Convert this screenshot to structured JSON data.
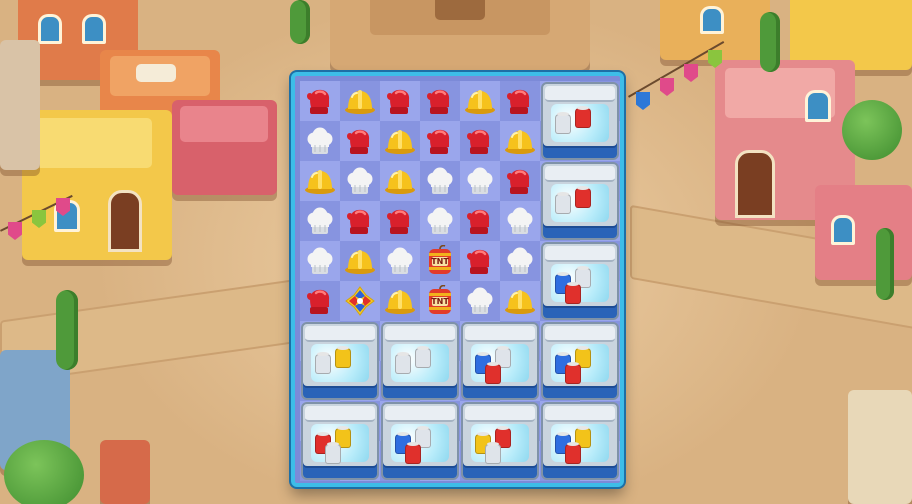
{
  "colors": {
    "board_frame": "#3dbde8",
    "cell_light": "#9aa6ec",
    "cell_dark": "#8794e0",
    "glove": "#d8202c",
    "hardhat": "#f6c21c",
    "chef_hat": "#f4f4f4",
    "tnt": "#e23a2a",
    "cooler_band": "#2a63b8",
    "can_red": "#e0302c",
    "can_blue": "#2f6ee0",
    "can_silver": "#dfe4ea",
    "can_yellow": "#f2c31a"
  },
  "board": {
    "columns": 8,
    "rows": 10,
    "tiles": [
      {
        "col": 0,
        "row": 0,
        "piece": "red-glove"
      },
      {
        "col": 1,
        "row": 0,
        "piece": "yellow-hardhat"
      },
      {
        "col": 2,
        "row": 0,
        "piece": "red-glove"
      },
      {
        "col": 3,
        "row": 0,
        "piece": "red-glove"
      },
      {
        "col": 4,
        "row": 0,
        "piece": "yellow-hardhat"
      },
      {
        "col": 5,
        "row": 0,
        "piece": "red-glove"
      },
      {
        "col": 0,
        "row": 1,
        "piece": "white-chef-hat"
      },
      {
        "col": 1,
        "row": 1,
        "piece": "red-glove"
      },
      {
        "col": 2,
        "row": 1,
        "piece": "yellow-hardhat"
      },
      {
        "col": 3,
        "row": 1,
        "piece": "red-glove"
      },
      {
        "col": 4,
        "row": 1,
        "piece": "red-glove"
      },
      {
        "col": 5,
        "row": 1,
        "piece": "yellow-hardhat"
      },
      {
        "col": 0,
        "row": 2,
        "piece": "yellow-hardhat"
      },
      {
        "col": 1,
        "row": 2,
        "piece": "white-chef-hat"
      },
      {
        "col": 2,
        "row": 2,
        "piece": "yellow-hardhat"
      },
      {
        "col": 3,
        "row": 2,
        "piece": "white-chef-hat"
      },
      {
        "col": 4,
        "row": 2,
        "piece": "white-chef-hat"
      },
      {
        "col": 5,
        "row": 2,
        "piece": "red-glove"
      },
      {
        "col": 0,
        "row": 3,
        "piece": "white-chef-hat"
      },
      {
        "col": 1,
        "row": 3,
        "piece": "red-glove"
      },
      {
        "col": 2,
        "row": 3,
        "piece": "red-glove"
      },
      {
        "col": 3,
        "row": 3,
        "piece": "white-chef-hat"
      },
      {
        "col": 4,
        "row": 3,
        "piece": "red-glove"
      },
      {
        "col": 5,
        "row": 3,
        "piece": "white-chef-hat"
      },
      {
        "col": 0,
        "row": 4,
        "piece": "white-chef-hat"
      },
      {
        "col": 1,
        "row": 4,
        "piece": "yellow-hardhat"
      },
      {
        "col": 2,
        "row": 4,
        "piece": "white-chef-hat"
      },
      {
        "col": 3,
        "row": 4,
        "piece": "tnt"
      },
      {
        "col": 4,
        "row": 4,
        "piece": "red-glove"
      },
      {
        "col": 5,
        "row": 4,
        "piece": "white-chef-hat"
      },
      {
        "col": 0,
        "row": 5,
        "piece": "red-glove"
      },
      {
        "col": 1,
        "row": 5,
        "piece": "propeller-booster"
      },
      {
        "col": 2,
        "row": 5,
        "piece": "yellow-hardhat"
      },
      {
        "col": 3,
        "row": 5,
        "piece": "tnt"
      },
      {
        "col": 4,
        "row": 5,
        "piece": "white-chef-hat"
      },
      {
        "col": 5,
        "row": 5,
        "piece": "yellow-hardhat"
      }
    ],
    "tnt_label": "TNT",
    "coolers": [
      {
        "col": 6,
        "row": 0,
        "cans": [
          "silver",
          "red"
        ]
      },
      {
        "col": 6,
        "row": 2,
        "cans": [
          "silver",
          "red"
        ]
      },
      {
        "col": 6,
        "row": 4,
        "cans": [
          "blue",
          "silver",
          "red"
        ]
      },
      {
        "col": 0,
        "row": 6,
        "cans": [
          "silver",
          "yellow"
        ]
      },
      {
        "col": 2,
        "row": 6,
        "cans": [
          "silver",
          "silver"
        ]
      },
      {
        "col": 4,
        "row": 6,
        "cans": [
          "blue",
          "silver",
          "red"
        ]
      },
      {
        "col": 6,
        "row": 6,
        "cans": [
          "blue",
          "yellow",
          "red"
        ]
      },
      {
        "col": 0,
        "row": 8,
        "cans": [
          "red",
          "yellow",
          "silver"
        ]
      },
      {
        "col": 2,
        "row": 8,
        "cans": [
          "blue",
          "silver",
          "red"
        ]
      },
      {
        "col": 4,
        "row": 8,
        "cans": [
          "yellow",
          "red",
          "silver"
        ]
      },
      {
        "col": 6,
        "row": 8,
        "cans": [
          "blue",
          "yellow",
          "red"
        ]
      }
    ]
  }
}
